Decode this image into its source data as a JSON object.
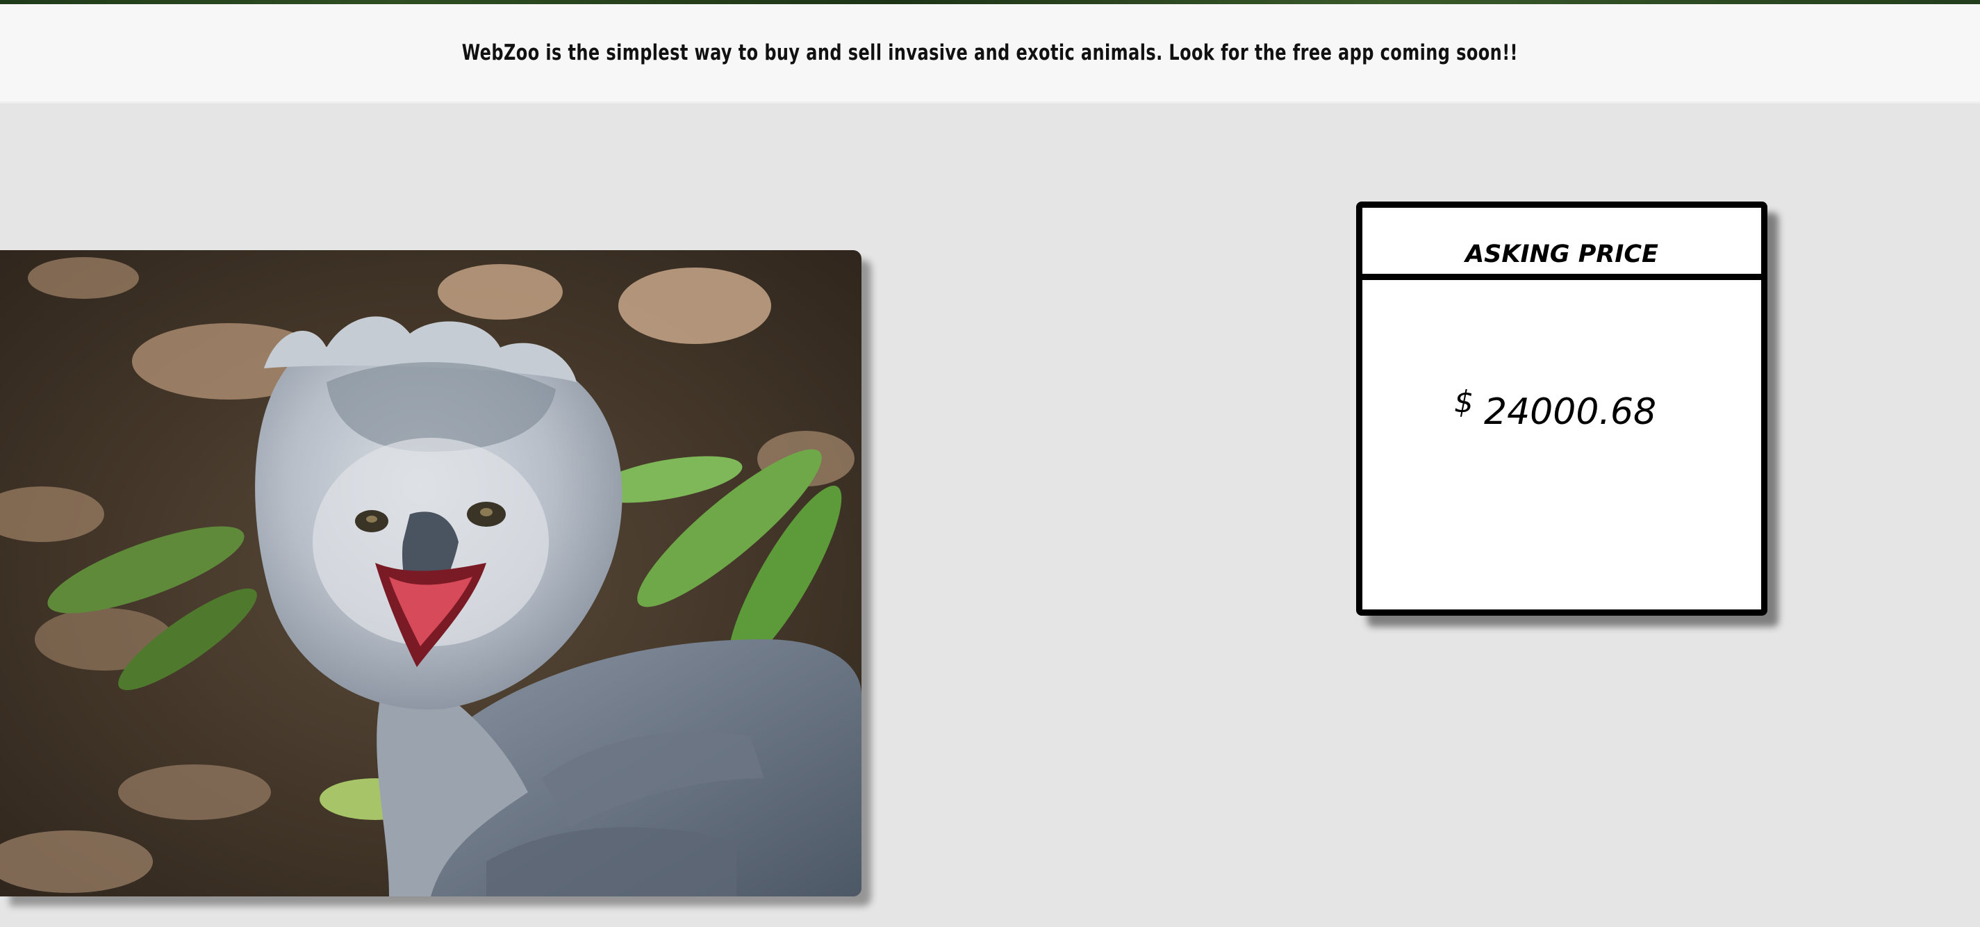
{
  "banner": {
    "text": "WebZoo is the simplest way to buy and sell invasive and exotic animals. Look for the free app coming soon!!"
  },
  "listing": {
    "photo_subject": "harpy eagle",
    "price_card": {
      "title": "ASKING PRICE",
      "currency_symbol": "$",
      "amount": "24000.68"
    }
  },
  "colors": {
    "page_background": "#e5e5e5",
    "banner_background": "#f7f7f7",
    "card_border": "#000000",
    "card_background": "#ffffff"
  }
}
